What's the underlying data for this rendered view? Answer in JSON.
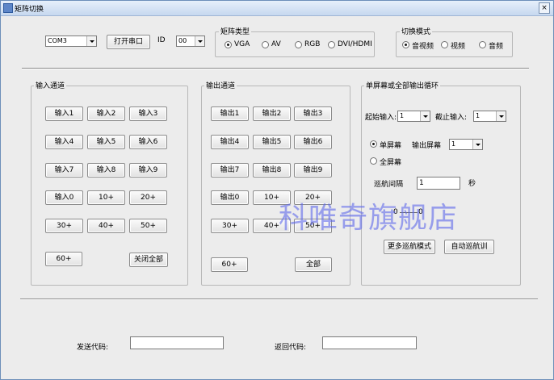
{
  "window": {
    "title": "矩阵切换",
    "close_glyph": "×"
  },
  "top": {
    "com_combo": "COM3",
    "open_port_button": "打开串口",
    "id_label": "ID",
    "id_combo": "00"
  },
  "matrix_type": {
    "group_label": "矩阵类型",
    "options": [
      "VGA",
      "AV",
      "RGB",
      "DVI/HDMI"
    ],
    "selected": "VGA"
  },
  "switch_mode": {
    "group_label": "切换模式",
    "options": [
      "音视频",
      "视频",
      "音频"
    ],
    "selected": "音视频"
  },
  "input_channel": {
    "group_label": "输入通道",
    "buttons": [
      "输入1",
      "输入2",
      "输入3",
      "输入4",
      "输入5",
      "输入6",
      "输入7",
      "输入8",
      "输入9",
      "输入0",
      "10+",
      "20+",
      "30+",
      "40+",
      "50+"
    ],
    "btn_60": "60+",
    "close_all": "关闭全部"
  },
  "output_channel": {
    "group_label": "输出通道",
    "buttons": [
      "输出1",
      "输出2",
      "输出3",
      "输出4",
      "输出5",
      "输出6",
      "输出7",
      "输出8",
      "输出9",
      "输出0",
      "10+",
      "20+",
      "30+",
      "40+",
      "50+"
    ],
    "btn_60": "60+",
    "all": "全部"
  },
  "cycle": {
    "group_label": "单屏幕或全部输出循环",
    "start_input_label": "起始输入:",
    "start_input_value": "1",
    "end_input_label": "截止输入:",
    "end_input_value": "1",
    "single_screen": "单屏幕",
    "output_screen_label": "输出屏幕",
    "output_screen_value": "1",
    "full_screen": "全屏幕",
    "cruise_interval_label": "巡航间隔",
    "cruise_interval_value": "1",
    "seconds_unit": "秒",
    "progress_left": "0",
    "progress_right": "0",
    "progress_fraction": 0,
    "more_cruise_button": "更多巡航模式",
    "auto_cruise_button": "自动巡航训"
  },
  "bottom": {
    "send_code_label": "发送代码:",
    "send_code_value": "",
    "return_code_label": "返回代码:",
    "return_code_value": ""
  },
  "watermark": "科唯奇旗舰店"
}
